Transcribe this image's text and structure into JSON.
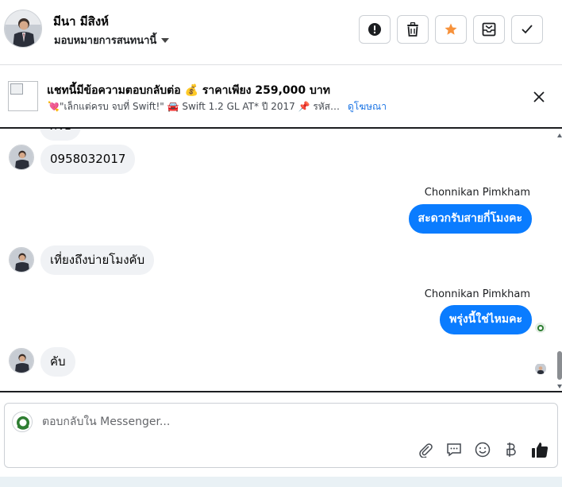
{
  "header": {
    "user_name": "มีนา มีสิงห์",
    "assign_label": "มอบหมายการสนทนานี้",
    "actions": [
      "alert-icon",
      "trash-icon",
      "star-icon",
      "mark-unread-icon",
      "check-icon"
    ],
    "star_color": "#f7923b"
  },
  "ad": {
    "title": "แชทนี้มีข้อความตอบกลับต่อ 💰 ราคาเพียง 259,000 บาท",
    "subtitle": "💘\"เล็กแต่ครบ จบที่ Swift!\" 🚘 Swift 1.2 GL AT* ปี 2017 📌 รหัสรถ: N...",
    "link_label": "ดูโฆษณา"
  },
  "messages": {
    "partial_top": "ครับ",
    "phone": "0958032017",
    "sender_1": "Chonnikan Pimkham",
    "out_1": "สะดวกรับสายกี่โมงคะ",
    "in_2": "เที่ยงถึงบ่ายโมงคับ",
    "sender_2": "Chonnikan Pimkham",
    "out_2": "พรุ่งนี้ใช่ไหมคะ",
    "in_3": "คับ"
  },
  "composer": {
    "placeholder": "ตอบกลับใน Messenger...",
    "tools": [
      "attach-icon",
      "saved-reply-icon",
      "emoji-icon",
      "baht-icon",
      "like-icon"
    ]
  },
  "colors": {
    "accent": "#0a7cff",
    "link": "#1b74e4",
    "incoming_bubble": "#f0f2f5"
  }
}
